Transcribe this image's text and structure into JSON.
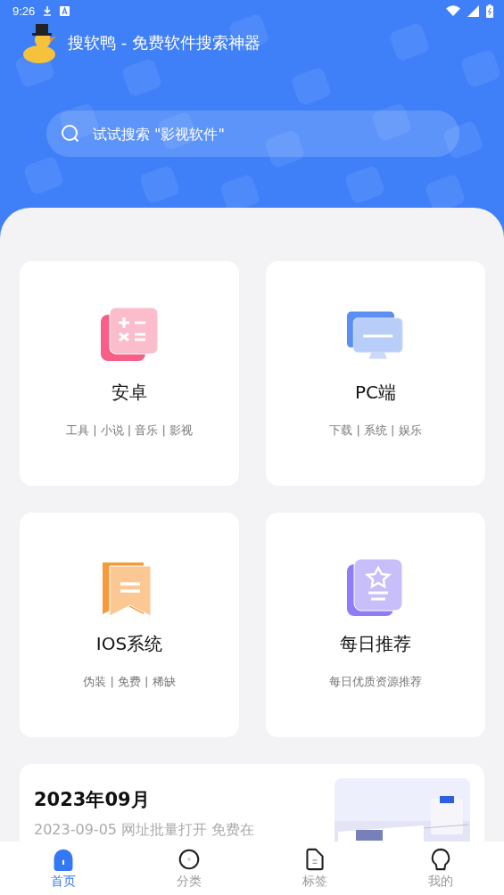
{
  "status_bar": {
    "time": "9:26"
  },
  "header": {
    "title": "搜软鸭 - 免费软件搜索神器"
  },
  "search": {
    "placeholder": "试试搜索 \"影视软件\""
  },
  "categories": [
    {
      "kind": "calculator",
      "name": "安卓",
      "tags": "工具 | 小说 | 音乐 | 影视"
    },
    {
      "kind": "monitor",
      "name": "PC端",
      "tags": "下载 | 系统 | 娱乐"
    },
    {
      "kind": "bookmark",
      "name": "IOS系统",
      "tags": "伪装 | 免费 | 稀缺"
    },
    {
      "kind": "star",
      "name": "每日推荐",
      "tags": "每日优质资源推荐"
    }
  ],
  "news": {
    "title": "2023年09月",
    "line": "2023-09-05 网址批量打开 免费在"
  },
  "nav": [
    {
      "kind": "home",
      "label": "首页",
      "selected": true
    },
    {
      "kind": "category",
      "label": "分类",
      "selected": false
    },
    {
      "kind": "tag",
      "label": "标签",
      "selected": false
    },
    {
      "kind": "me",
      "label": "我的",
      "selected": false
    }
  ]
}
